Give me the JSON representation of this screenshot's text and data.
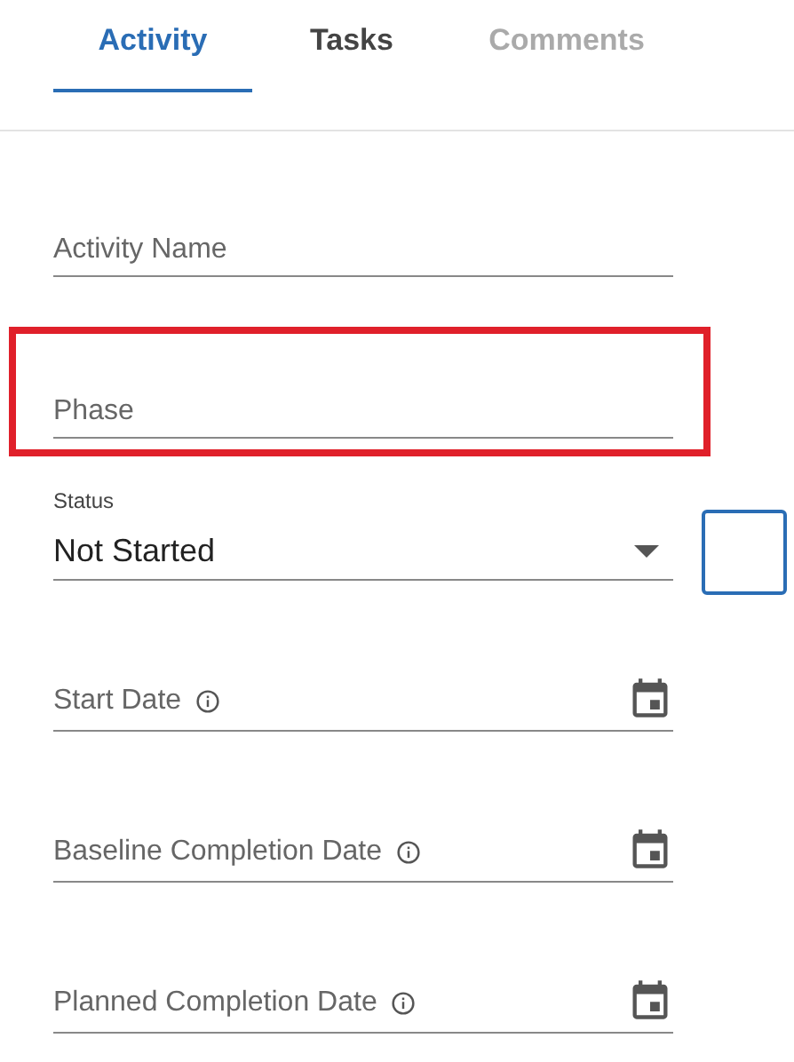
{
  "tabs": [
    {
      "label": "Activity",
      "selected": true,
      "disabled": false
    },
    {
      "label": "Tasks",
      "selected": false,
      "disabled": false
    },
    {
      "label": "Comments",
      "selected": false,
      "disabled": true
    }
  ],
  "fields": [
    {
      "kind": "text",
      "placeholder": "Activity Name",
      "highlighted": false
    },
    {
      "kind": "text",
      "placeholder": "Phase",
      "highlighted": true
    },
    {
      "kind": "select",
      "label": "Status",
      "value": "Not Started",
      "highlighted": false
    },
    {
      "kind": "date",
      "placeholder": "Start Date",
      "info": true,
      "highlighted": false
    },
    {
      "kind": "date",
      "placeholder": "Baseline Completion Date",
      "info": true,
      "highlighted": false
    },
    {
      "kind": "date",
      "placeholder": "Planned Completion Date",
      "info": true,
      "highlighted": false
    }
  ]
}
